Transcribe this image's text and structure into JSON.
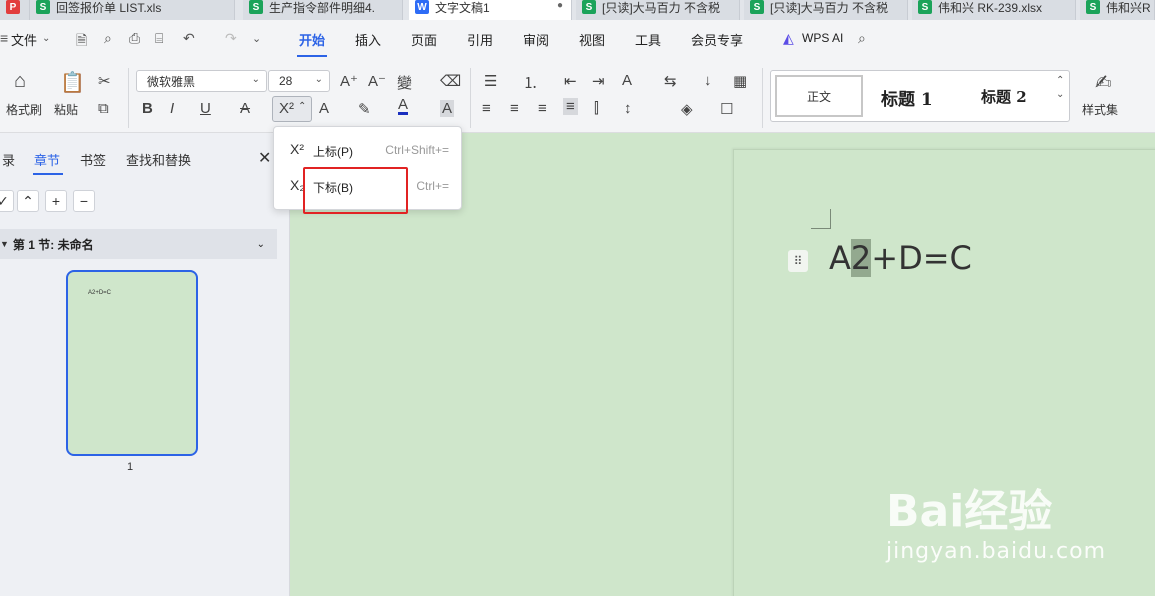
{
  "tabs": [
    {
      "label": "回签报价单 LIST.xls",
      "icon": "sheet-icon",
      "type": "s"
    },
    {
      "label": "生产指令部件明细4.",
      "icon": "sheet-icon",
      "type": "s"
    },
    {
      "label": "文字文稿1",
      "icon": "doc-icon",
      "type": "w"
    },
    {
      "label": "[只读]大马百力 不含税",
      "icon": "sheet-icon",
      "type": "s"
    },
    {
      "label": "[只读]大马百力 不含税",
      "icon": "sheet-icon",
      "type": "s"
    },
    {
      "label": "伟和兴 RK-239.xlsx",
      "icon": "sheet-icon",
      "type": "s"
    },
    {
      "label": "伟和兴R",
      "icon": "sheet-icon",
      "type": "s"
    }
  ],
  "menubar": {
    "file": "文件",
    "items": [
      "开始",
      "插入",
      "页面",
      "引用",
      "审阅",
      "视图",
      "工具",
      "会员专享"
    ],
    "ai": "WPS AI"
  },
  "ribbon": {
    "format_painter": "格式刷",
    "paste": "粘贴",
    "font_name": "微软雅黑",
    "font_size": "28",
    "styles": {
      "normal": "正文",
      "h1": "标题  1",
      "h2": "标题  2",
      "set": "样式集"
    }
  },
  "left_panel": {
    "tabs": [
      "录",
      "章节",
      "书签",
      "查找和替换"
    ],
    "section": "第 1 节: 未命名",
    "thumb_text": "A2+D=C",
    "page_number": "1"
  },
  "document": {
    "pre": "A",
    "selected": "2",
    "post": "+D=C"
  },
  "dropdown": {
    "superscript_label": "上标(P)",
    "superscript_shortcut": "Ctrl+Shift+=",
    "subscript_label": "下标(B)",
    "subscript_shortcut": "Ctrl+="
  },
  "watermark": {
    "main": "Bai经验",
    "sub": "jingyan.baidu.com"
  },
  "colors": {
    "accent": "#2c63e6",
    "highlight": "#e12323",
    "doc_bg": "#cfe6cb"
  }
}
